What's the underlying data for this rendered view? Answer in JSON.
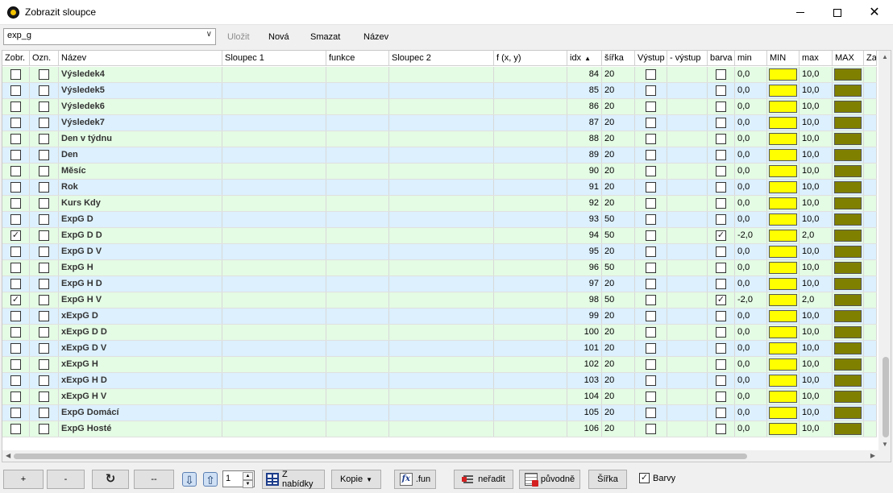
{
  "window": {
    "title": "Zobrazit sloupce",
    "close_glyph": "✕"
  },
  "toolbar": {
    "preset_value": "exp_g",
    "save_label": "Uložit",
    "new_label": "Nová",
    "delete_label": "Smazat",
    "name_label": "Název"
  },
  "colors": {
    "row_green": "#e4fbe4",
    "row_blue": "#dcf0fd",
    "min_swatch": "#ffff00",
    "max_swatch": "#808000"
  },
  "columns": [
    "Zobr.",
    "Ozn.",
    "Název",
    "Sloupec 1",
    "funkce",
    "Sloupec 2",
    "f (x, y)",
    "idx",
    "šířka",
    "Výstup",
    "- výstup",
    "barva",
    "min",
    "MIN",
    "max",
    "MAX",
    "Za"
  ],
  "sort_indicator": "▲",
  "rows": [
    {
      "zobr": false,
      "ozn": false,
      "nazev": "Výsledek4",
      "idx": "84",
      "sirka": "20",
      "vystup": false,
      "barva": false,
      "min": "0,0",
      "max": "10,0"
    },
    {
      "zobr": false,
      "ozn": false,
      "nazev": "Výsledek5",
      "idx": "85",
      "sirka": "20",
      "vystup": false,
      "barva": false,
      "min": "0,0",
      "max": "10,0"
    },
    {
      "zobr": false,
      "ozn": false,
      "nazev": "Výsledek6",
      "idx": "86",
      "sirka": "20",
      "vystup": false,
      "barva": false,
      "min": "0,0",
      "max": "10,0"
    },
    {
      "zobr": false,
      "ozn": false,
      "nazev": "Výsledek7",
      "idx": "87",
      "sirka": "20",
      "vystup": false,
      "barva": false,
      "min": "0,0",
      "max": "10,0"
    },
    {
      "zobr": false,
      "ozn": false,
      "nazev": "Den v týdnu",
      "idx": "88",
      "sirka": "20",
      "vystup": false,
      "barva": false,
      "min": "0,0",
      "max": "10,0"
    },
    {
      "zobr": false,
      "ozn": false,
      "nazev": "Den",
      "idx": "89",
      "sirka": "20",
      "vystup": false,
      "barva": false,
      "min": "0,0",
      "max": "10,0"
    },
    {
      "zobr": false,
      "ozn": false,
      "nazev": "Měsíc",
      "idx": "90",
      "sirka": "20",
      "vystup": false,
      "barva": false,
      "min": "0,0",
      "max": "10,0"
    },
    {
      "zobr": false,
      "ozn": false,
      "nazev": "Rok",
      "idx": "91",
      "sirka": "20",
      "vystup": false,
      "barva": false,
      "min": "0,0",
      "max": "10,0"
    },
    {
      "zobr": false,
      "ozn": false,
      "nazev": "Kurs Kdy",
      "idx": "92",
      "sirka": "20",
      "vystup": false,
      "barva": false,
      "min": "0,0",
      "max": "10,0"
    },
    {
      "zobr": false,
      "ozn": false,
      "nazev": "ExpG D",
      "idx": "93",
      "sirka": "50",
      "vystup": false,
      "barva": false,
      "min": "0,0",
      "max": "10,0"
    },
    {
      "zobr": true,
      "ozn": false,
      "nazev": "ExpG D D",
      "idx": "94",
      "sirka": "50",
      "vystup": false,
      "barva": true,
      "min": "-2,0",
      "max": "2,0"
    },
    {
      "zobr": false,
      "ozn": false,
      "nazev": "ExpG D V",
      "idx": "95",
      "sirka": "20",
      "vystup": false,
      "barva": false,
      "min": "0,0",
      "max": "10,0"
    },
    {
      "zobr": false,
      "ozn": false,
      "nazev": "ExpG H",
      "idx": "96",
      "sirka": "50",
      "vystup": false,
      "barva": false,
      "min": "0,0",
      "max": "10,0"
    },
    {
      "zobr": false,
      "ozn": false,
      "nazev": "ExpG H D",
      "idx": "97",
      "sirka": "20",
      "vystup": false,
      "barva": false,
      "min": "0,0",
      "max": "10,0"
    },
    {
      "zobr": true,
      "ozn": false,
      "nazev": "ExpG H V",
      "idx": "98",
      "sirka": "50",
      "vystup": false,
      "barva": true,
      "min": "-2,0",
      "max": "2,0"
    },
    {
      "zobr": false,
      "ozn": false,
      "nazev": "xExpG D",
      "idx": "99",
      "sirka": "20",
      "vystup": false,
      "barva": false,
      "min": "0,0",
      "max": "10,0"
    },
    {
      "zobr": false,
      "ozn": false,
      "nazev": "xExpG D D",
      "idx": "100",
      "sirka": "20",
      "vystup": false,
      "barva": false,
      "min": "0,0",
      "max": "10,0"
    },
    {
      "zobr": false,
      "ozn": false,
      "nazev": "xExpG D V",
      "idx": "101",
      "sirka": "20",
      "vystup": false,
      "barva": false,
      "min": "0,0",
      "max": "10,0"
    },
    {
      "zobr": false,
      "ozn": false,
      "nazev": "xExpG H",
      "idx": "102",
      "sirka": "20",
      "vystup": false,
      "barva": false,
      "min": "0,0",
      "max": "10,0"
    },
    {
      "zobr": false,
      "ozn": false,
      "nazev": "xExpG H D",
      "idx": "103",
      "sirka": "20",
      "vystup": false,
      "barva": false,
      "min": "0,0",
      "max": "10,0"
    },
    {
      "zobr": false,
      "ozn": false,
      "nazev": "xExpG H V",
      "idx": "104",
      "sirka": "20",
      "vystup": false,
      "barva": false,
      "min": "0,0",
      "max": "10,0"
    },
    {
      "zobr": false,
      "ozn": false,
      "nazev": "ExpG Domácí",
      "idx": "105",
      "sirka": "20",
      "vystup": false,
      "barva": false,
      "min": "0,0",
      "max": "10,0"
    },
    {
      "zobr": false,
      "ozn": false,
      "nazev": "ExpG Hosté",
      "idx": "106",
      "sirka": "20",
      "vystup": false,
      "barva": false,
      "min": "0,0",
      "max": "10,0"
    }
  ],
  "bottombar": {
    "add_label": "+",
    "remove_label": "-",
    "clear_label": "--",
    "spin_value": "1",
    "from_menu_label": "Z nabídky",
    "copy_label": "Kopie",
    "fun_label": ".fun",
    "unsort_label": "neřadit",
    "original_label": "původně",
    "width_label": "Šířka",
    "colors_label": "Barvy",
    "colors_checked": true
  }
}
